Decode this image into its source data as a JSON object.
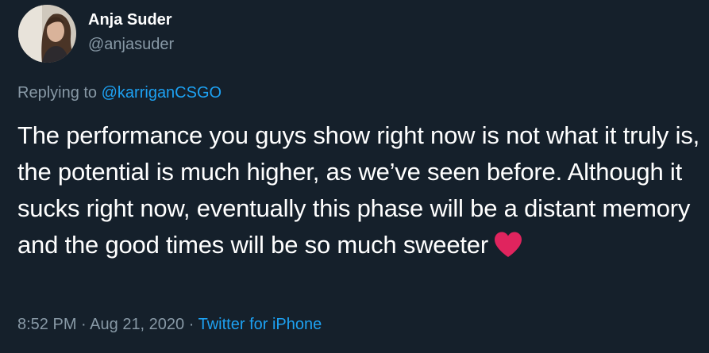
{
  "author": {
    "display_name": "Anja Suder",
    "handle": "@anjasuder"
  },
  "reply": {
    "prefix": "Replying to",
    "mention": "@karriganCSGO"
  },
  "tweet": {
    "text": "The performance you guys show right now is not what it truly is, the potential is much higher, as we’ve seen before. Although it sucks right now, eventually this phase will be a distant memory and the good times will be so much sweeter",
    "emoji": "heart-emoji"
  },
  "meta": {
    "time": "8:52 PM",
    "separator": "·",
    "date": "Aug 21, 2020",
    "source": "Twitter for iPhone"
  },
  "colors": {
    "background": "#15202b",
    "text": "#ffffff",
    "secondary": "#8899a6",
    "link": "#1da1f2",
    "heart": "#e0245e"
  }
}
